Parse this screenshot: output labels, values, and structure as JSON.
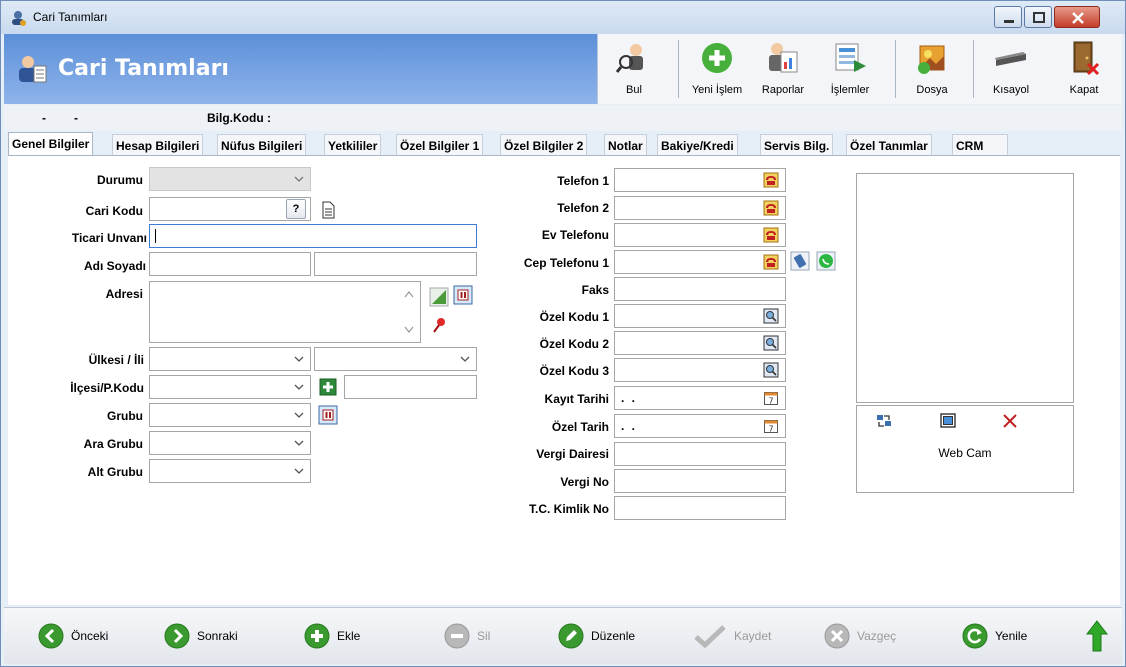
{
  "window": {
    "title": "Cari Tanımları"
  },
  "header": {
    "title": "Cari Tanımları"
  },
  "toolbar": {
    "buttons": [
      {
        "label": "Bul",
        "icon": "search-person-icon"
      },
      {
        "label": "Yeni İşlem",
        "icon": "add-icon"
      },
      {
        "label": "Raporlar",
        "icon": "report-icon"
      },
      {
        "label": "İşlemler",
        "icon": "operations-icon"
      },
      {
        "label": "Dosya",
        "icon": "file-icon"
      },
      {
        "label": "Kısayol",
        "icon": "shortcut-icon"
      },
      {
        "label": "Kapat",
        "icon": "exit-door-icon"
      }
    ]
  },
  "inforow": {
    "dash1": "-",
    "dash2": "-",
    "bilg_label": "Bilg.Kodu :"
  },
  "tabs": [
    {
      "label": "Genel Bilgiler",
      "active": true
    },
    {
      "label": "Hesap Bilgileri"
    },
    {
      "label": "Nüfus Bilgileri"
    },
    {
      "label": "Yetkililer"
    },
    {
      "label": "Özel Bilgiler 1"
    },
    {
      "label": "Özel Bilgiler 2"
    },
    {
      "label": "Notlar"
    },
    {
      "label": "Bakiye/Kredi"
    },
    {
      "label": "Servis Bilg."
    },
    {
      "label": "Özel Tanımlar"
    },
    {
      "label": "CRM"
    }
  ],
  "form_left": {
    "durumu": "Durumu",
    "cari_kodu": "Cari Kodu",
    "cari_kodu_help": "?",
    "ticari_unvani": "Ticari Unvanı",
    "adi_soyadi": "Adı Soyadı",
    "adresi": "Adresi",
    "ulkesi_ili": "Ülkesi / İli",
    "ilcesi_pkodu": "İlçesi/P.Kodu",
    "grubu": "Grubu",
    "ara_grubu": "Ara Grubu",
    "alt_grubu": "Alt Grubu"
  },
  "form_right": {
    "telefon1": "Telefon 1",
    "telefon2": "Telefon 2",
    "ev_telefonu": "Ev Telefonu",
    "cep_telefonu1": "Cep Telefonu 1",
    "faks": "Faks",
    "ozel_kodu1": "Özel Kodu 1",
    "ozel_kodu2": "Özel Kodu 2",
    "ozel_kodu3": "Özel Kodu 3",
    "kayit_tarihi": "Kayıt Tarihi",
    "kayit_tarihi_value": ". .",
    "ozel_tarih": "Özel Tarih",
    "ozel_tarih_value": ". .",
    "vergi_dairesi": "Vergi Dairesi",
    "vergi_no": "Vergi No",
    "tc_kimlik_no": "T.C. Kimlik No"
  },
  "camera": {
    "label": "Web Cam"
  },
  "bottombar": {
    "buttons": [
      {
        "label": "Önceki",
        "enabled": true
      },
      {
        "label": "Sonraki",
        "enabled": true
      },
      {
        "label": "Ekle",
        "enabled": true
      },
      {
        "label": "Sil",
        "enabled": false
      },
      {
        "label": "Düzenle",
        "enabled": true
      },
      {
        "label": "Kaydet",
        "enabled": false
      },
      {
        "label": "Vazgeç",
        "enabled": false
      },
      {
        "label": "Yenile",
        "enabled": true
      }
    ]
  },
  "colors": {
    "header_gradient_start": "#5c8fd8",
    "header_gradient_end": "#8eb4ea",
    "focus_border": "#3d7bd4",
    "nav_green": "#3a9a2f"
  }
}
